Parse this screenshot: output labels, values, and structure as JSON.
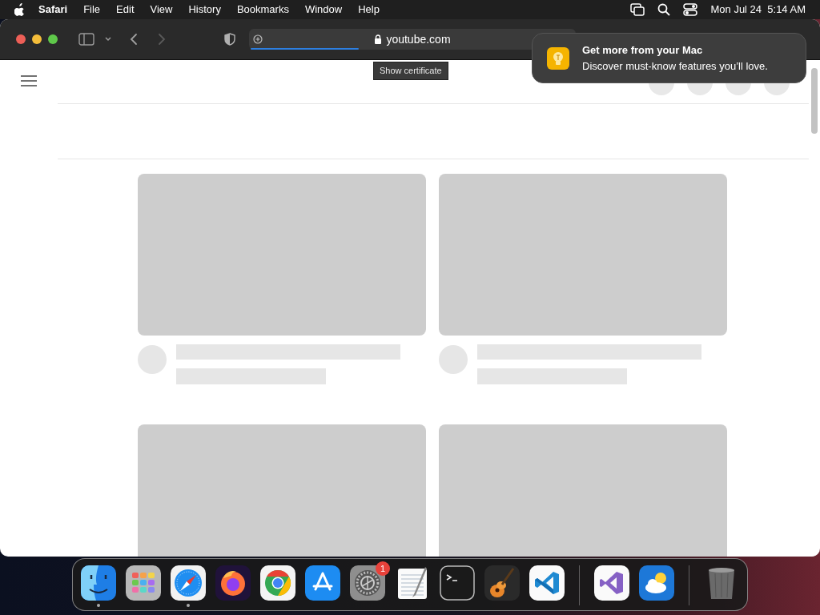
{
  "menubar": {
    "app": "Safari",
    "menus": [
      "File",
      "Edit",
      "View",
      "History",
      "Bookmarks",
      "Window",
      "Help"
    ],
    "clock": "Mon Jul 24  5:14 AM"
  },
  "toolbar": {
    "back": {
      "disabled": false
    },
    "forward": {
      "disabled": true
    },
    "address": {
      "text": "youtube.com",
      "secure": true,
      "level": 0.33
    },
    "tooltip": "Show certificate"
  },
  "notification": {
    "title": "Get more from your Mac",
    "body": "Discover must-know features you’ll love."
  },
  "dock": {
    "sections": [
      {
        "items": [
          {
            "kind": "finder",
            "running": true
          },
          {
            "kind": "launchpad",
            "running": false
          },
          {
            "kind": "safari",
            "running": true
          },
          {
            "kind": "firefox",
            "running": false
          },
          {
            "kind": "chrome",
            "running": false
          },
          {
            "kind": "appstore",
            "running": false
          },
          {
            "kind": "settings",
            "running": false,
            "badge": "1"
          },
          {
            "kind": "textedit",
            "running": false
          },
          {
            "kind": "terminal",
            "running": false
          },
          {
            "kind": "garageband",
            "running": false
          },
          {
            "kind": "vscode",
            "running": false
          }
        ]
      },
      {
        "items": [
          {
            "kind": "visualstudio",
            "running": false
          },
          {
            "kind": "weather",
            "running": false
          }
        ]
      },
      {
        "items": [
          {
            "kind": "trash",
            "running": false
          }
        ]
      }
    ]
  }
}
